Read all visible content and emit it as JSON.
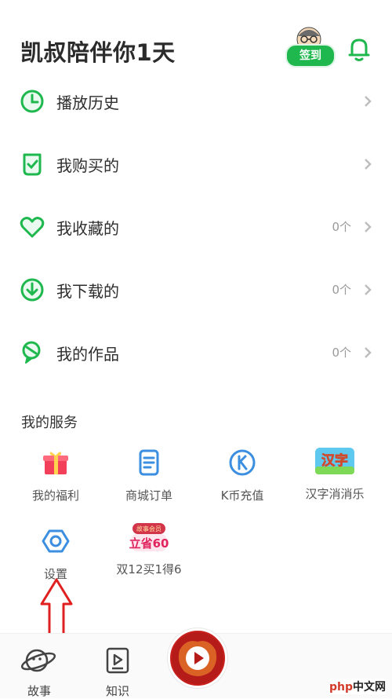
{
  "header": {
    "title": "凯叔陪伴你1天",
    "signin_label": "签到",
    "bell_icon": "bell-icon"
  },
  "menu": [
    {
      "label": "播放历史",
      "count": "",
      "icon": "clock-icon"
    },
    {
      "label": "我购买的",
      "count": "",
      "icon": "purchase-bag-icon"
    },
    {
      "label": "我收藏的",
      "count": "0个",
      "icon": "heart-icon"
    },
    {
      "label": "我下载的",
      "count": "0个",
      "icon": "download-icon"
    },
    {
      "label": "我的作品",
      "count": "0个",
      "icon": "works-icon"
    }
  ],
  "services": {
    "title": "我的服务",
    "items": [
      {
        "label": "我的福利",
        "icon": "gift-icon"
      },
      {
        "label": "商城订单",
        "icon": "order-icon"
      },
      {
        "label": "K币充值",
        "icon": "k-coin-icon"
      },
      {
        "label": "汉字消消乐",
        "icon": "hanzi-game-icon",
        "badge": "汉字"
      },
      {
        "label": "设置",
        "icon": "settings-icon"
      },
      {
        "label": "双12买1得6",
        "icon": "promo-icon",
        "badge_top": "故事会员",
        "badge_main": "立省60"
      }
    ]
  },
  "tabbar": {
    "tabs": [
      {
        "label": "故事",
        "icon": "planet-icon"
      },
      {
        "label": "知识",
        "icon": "video-book-icon"
      }
    ],
    "center_icon": "play-icon"
  },
  "watermark": {
    "part1": "php",
    "part2": "中文网"
  },
  "colors": {
    "accent": "#1fb84e",
    "chevron": "#bdbdbd",
    "arrow": "#e02020",
    "gift": "#f2405a",
    "blue": "#3c8fe0"
  }
}
